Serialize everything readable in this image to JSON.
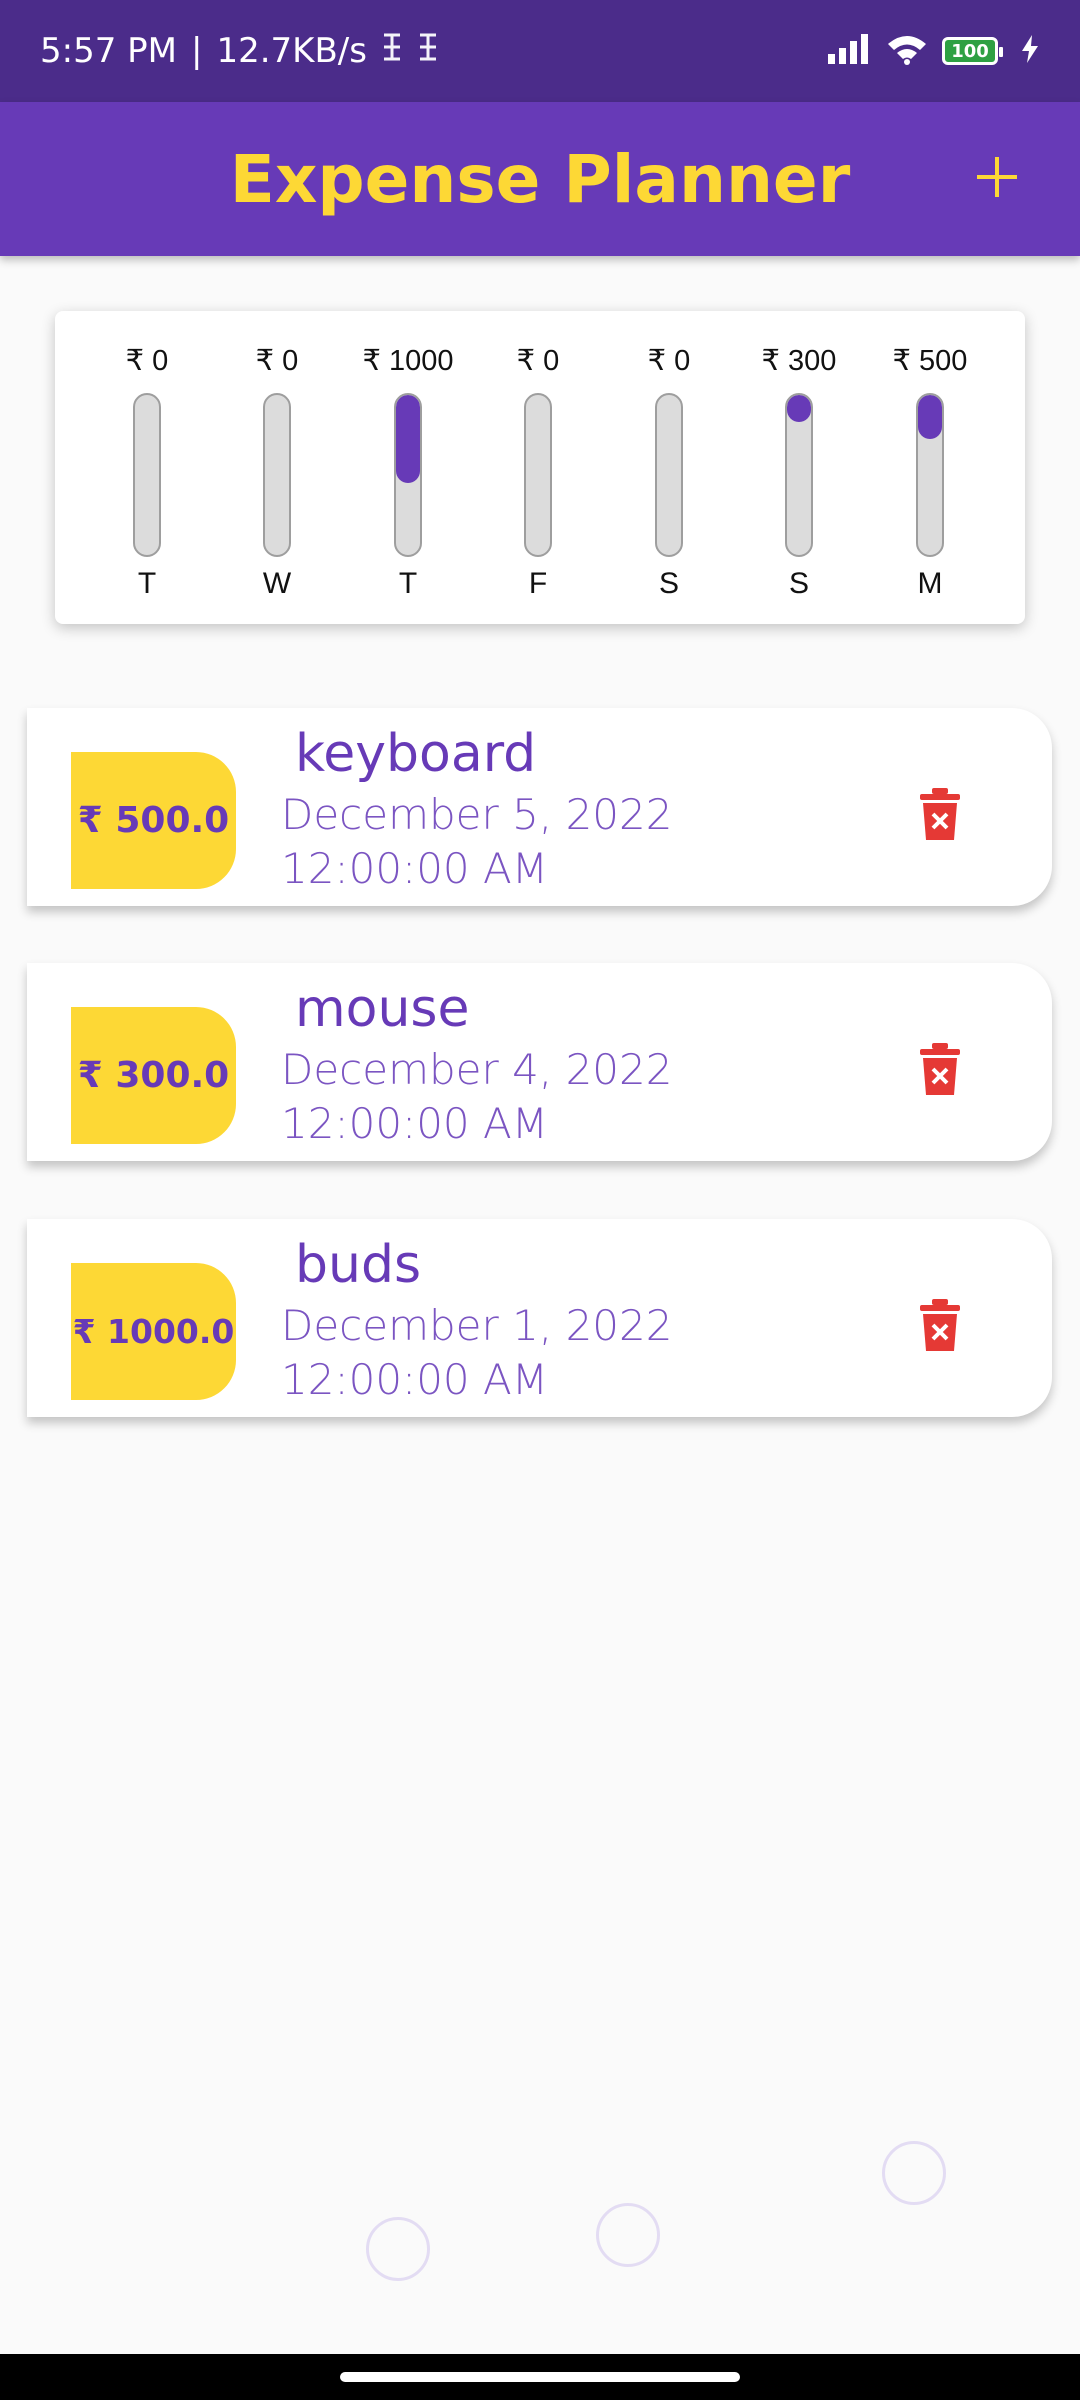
{
  "status_bar": {
    "time": "5:57 PM",
    "separator": "|",
    "network_speed": "12.7KB/s",
    "battery": "100",
    "icons": [
      "sim-icon",
      "sim-icon",
      "signal-icon",
      "wifi-icon",
      "battery-icon",
      "charging-icon"
    ]
  },
  "app_bar": {
    "title": "Expense Planner",
    "add_label": "+"
  },
  "chart_data": {
    "type": "bar",
    "categories": [
      "T",
      "W",
      "T",
      "F",
      "S",
      "S",
      "M"
    ],
    "labels": [
      "₹ 0",
      "₹ 0",
      "₹ 1000",
      "₹ 0",
      "₹ 0",
      "₹ 300",
      "₹ 500"
    ],
    "values": [
      0,
      0,
      1000,
      0,
      0,
      300,
      500
    ],
    "fill_fraction": [
      0,
      0,
      0.55,
      0,
      0,
      0.166,
      0.276
    ],
    "colors": {
      "fill": "#673ab7",
      "track": "#dcdcdc"
    }
  },
  "transactions": [
    {
      "amount": "₹ 500.0",
      "title": "keyboard",
      "date": "December 5, 2022 12:00:00 AM"
    },
    {
      "amount": "₹ 300.0",
      "title": "mouse",
      "date": "December 4, 2022 12:00:00 AM"
    },
    {
      "amount": "₹ 1000.0",
      "title": "buds",
      "date": "December 1, 2022 12:00:00 AM"
    }
  ],
  "colors": {
    "primary": "#673ab7",
    "accent": "#fdd835",
    "delete": "#e53935"
  }
}
